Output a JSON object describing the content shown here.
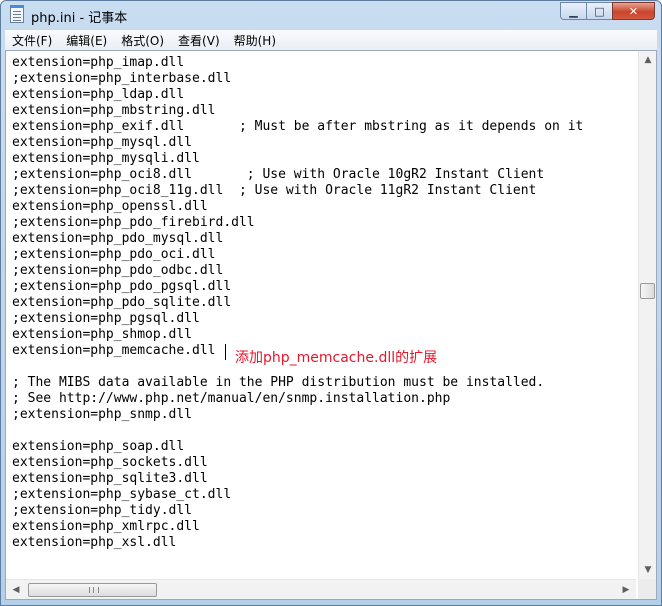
{
  "window": {
    "title": "php.ini - 记事本",
    "controls": {
      "minimize": "▁",
      "maximize": "□",
      "close": "✕"
    }
  },
  "menu": [
    {
      "label": "文件(F)"
    },
    {
      "label": "编辑(E)"
    },
    {
      "label": "格式(O)"
    },
    {
      "label": "查看(V)"
    },
    {
      "label": "帮助(H)"
    }
  ],
  "editor": {
    "lines": [
      "extension=php_imap.dll",
      ";extension=php_interbase.dll",
      "extension=php_ldap.dll",
      "extension=php_mbstring.dll",
      "extension=php_exif.dll       ; Must be after mbstring as it depends on it",
      "extension=php_mysql.dll",
      "extension=php_mysqli.dll",
      ";extension=php_oci8.dll       ; Use with Oracle 10gR2 Instant Client",
      ";extension=php_oci8_11g.dll  ; Use with Oracle 11gR2 Instant Client",
      "extension=php_openssl.dll",
      ";extension=php_pdo_firebird.dll",
      "extension=php_pdo_mysql.dll",
      ";extension=php_pdo_oci.dll",
      ";extension=php_pdo_odbc.dll",
      ";extension=php_pdo_pgsql.dll",
      "extension=php_pdo_sqlite.dll",
      ";extension=php_pgsql.dll",
      "extension=php_shmop.dll",
      "extension=php_memcache.dll",
      "",
      "; The MIBS data available in the PHP distribution must be installed.",
      "; See http://www.php.net/manual/en/snmp.installation.php",
      ";extension=php_snmp.dll",
      "",
      "extension=php_soap.dll",
      "extension=php_sockets.dll",
      "extension=php_sqlite3.dll",
      ";extension=php_sybase_ct.dll",
      ";extension=php_tidy.dll",
      "extension=php_xmlrpc.dll",
      "extension=php_xsl.dll"
    ],
    "annotation": "添加php_memcache.dll的扩展"
  },
  "scrollbars": {
    "up_arrow": "▲",
    "down_arrow": "▼",
    "left_arrow": "◀",
    "right_arrow": "▶"
  }
}
